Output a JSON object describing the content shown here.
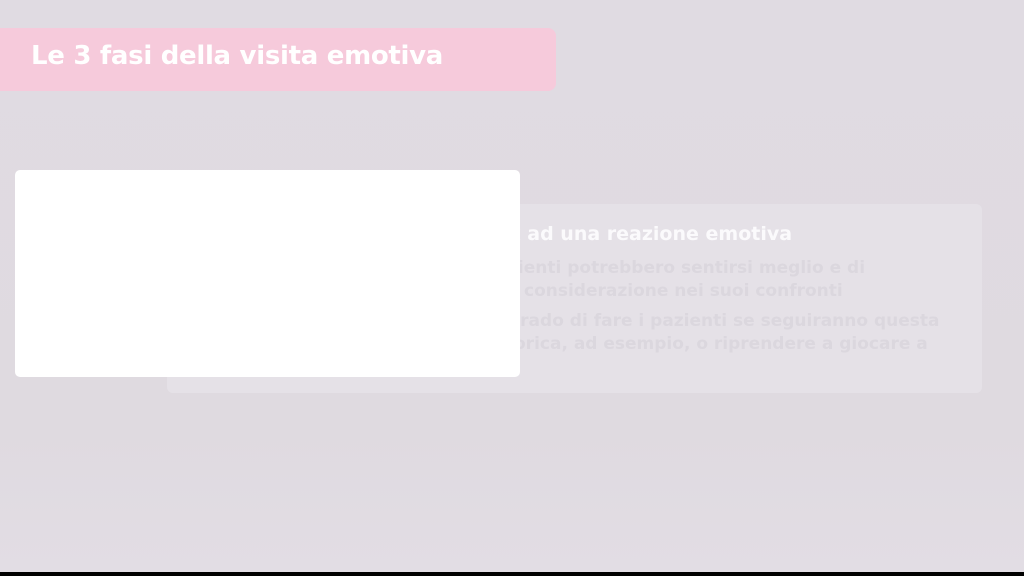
{
  "slide": {
    "title": "Le 3 fasi della visita emotiva",
    "card": {
      "heading": "vx ad una reazione emotiva",
      "lines": [
        "zienti potrebbero sentirsi meglio e di",
        "considerazione nei suoi confronti",
        "grado di fare i pazienti se seguiranno questa",
        "orica, ad esempio, o riprendere a giocare a"
      ]
    }
  },
  "colors": {
    "background": "#e0dbe2",
    "title_banner": "#f6cadb",
    "title_text": "#ffffff",
    "panel": "#ffffff"
  }
}
